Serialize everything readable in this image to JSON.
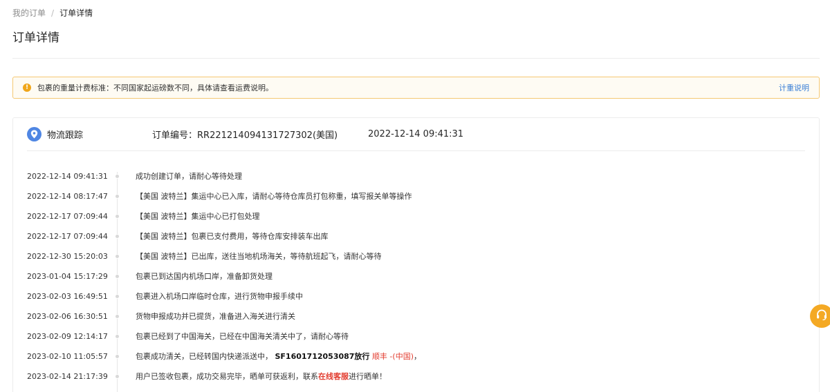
{
  "breadcrumb": {
    "parent": "我的订单",
    "separator": "/",
    "current": "订单详情"
  },
  "page_title": "订单详情",
  "notice": {
    "text": "包裹的重量计费标准：不同国家起运磅数不同，具体请查看运费说明。",
    "link": "计重说明"
  },
  "tracking": {
    "title": "物流跟踪",
    "order_number": "订单编号：RR221214094131727302(美国)",
    "order_time": "2022-12-14 09:41:31",
    "events": [
      {
        "time": "2022-12-14 09:41:31",
        "desc": "成功创建订单，请耐心等待处理"
      },
      {
        "time": "2022-12-14 08:17:47",
        "desc": "【美国 波特兰】集运中心已入库，请耐心等待仓库员打包称重，填写报关单等操作"
      },
      {
        "time": "2022-12-17 07:09:44",
        "desc": "【美国 波特兰】集运中心已打包处理"
      },
      {
        "time": "2022-12-17 07:09:44",
        "desc": "【美国 波特兰】包裹已支付费用，等待仓库安排装车出库"
      },
      {
        "time": "2022-12-30 15:20:03",
        "desc": "【美国 波特兰】已出库，送往当地机场海关，等待航班起飞，请耐心等待"
      },
      {
        "time": "2023-01-04 15:17:29",
        "desc": "包裹已到达国内机场口岸，准备卸货处理"
      },
      {
        "time": "2023-02-03 16:49:51",
        "desc": "包裹进入机场口岸临时仓库，进行货物申报手续中"
      },
      {
        "time": "2023-02-06 16:30:51",
        "desc": "货物申报成功并已提货，准备进入海关进行清关"
      },
      {
        "time": "2023-02-09 12:14:17",
        "desc": "包裹已经到了中国海关，已经在中国海关清关中了，请耐心等待"
      },
      {
        "time": "2023-02-10 11:05:57",
        "desc_prefix": "包裹成功清关，已经转国内快递派送中，",
        "tracking_no": "SF1601712053087放行",
        "carrier": "顺丰 -(中国)",
        "desc_suffix": "，"
      },
      {
        "time": "2023-02-14 21:17:39",
        "desc_prefix": "用户已签收包裹，成功交易完毕，晒单可获返利，联系",
        "service_link": "在线客服",
        "desc_suffix": "进行晒单！"
      }
    ]
  },
  "colors": {
    "accent": "#3a7fd6",
    "warning": "#f0a61a",
    "highlight": "#e23b2e",
    "pin": "#4f86e3",
    "support": "#f4a924"
  },
  "support_icon": "headset-icon"
}
